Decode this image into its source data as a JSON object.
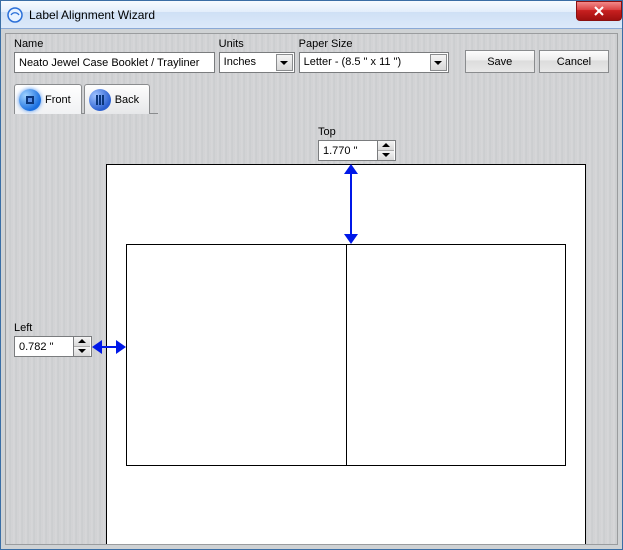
{
  "window": {
    "title": "Label Alignment Wizard"
  },
  "fields": {
    "name": {
      "label": "Name",
      "value": "Neato Jewel Case Booklet / Trayliner"
    },
    "units": {
      "label": "Units",
      "value": "Inches"
    },
    "paper": {
      "label": "Paper Size",
      "value": "Letter - (8.5 \" x 11 \")"
    }
  },
  "buttons": {
    "save": "Save",
    "cancel": "Cancel"
  },
  "tabs": {
    "front": "Front",
    "back": "Back"
  },
  "offsets": {
    "top": {
      "label": "Top",
      "value": "1.770 \""
    },
    "left": {
      "label": "Left",
      "value": "0.782 \""
    }
  }
}
